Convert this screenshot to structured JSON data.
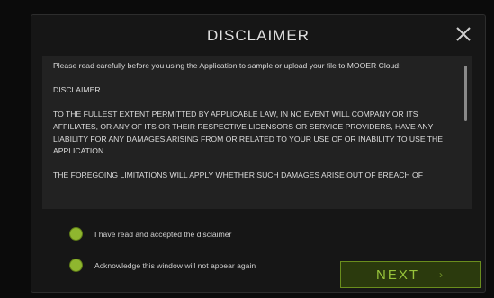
{
  "dialog": {
    "title": "DISCLAIMER",
    "close_icon": "close-icon"
  },
  "disclaimer": {
    "paragraphs": [
      "Please read carefully before you using the Application to sample or upload your file to MOOER Cloud:",
      "DISCLAIMER",
      "TO THE FULLEST EXTENT PERMITTED BY APPLICABLE LAW, IN NO EVENT WILL COMPANY OR ITS AFFILIATES, OR ANY OF ITS OR THEIR RESPECTIVE LICENSORS OR SERVICE PROVIDERS, HAVE ANY LIABILITY FOR ANY DAMAGES ARISING FROM OR RELATED TO YOUR USE OF OR INABILITY TO USE THE APPLICATION.",
      "THE FOREGOING LIMITATIONS WILL APPLY WHETHER SUCH DAMAGES ARISE OUT OF BREACH OF"
    ]
  },
  "options": {
    "accept_label": "I have read and accepted the disclaimer",
    "acknowledge_label": "Acknowledge this window will not appear again"
  },
  "buttons": {
    "next_label": "NEXT",
    "next_chevron": "›"
  },
  "colors": {
    "accent_green": "#8fb62f",
    "button_bg": "#2b3a0d",
    "button_text": "#97c33a"
  }
}
